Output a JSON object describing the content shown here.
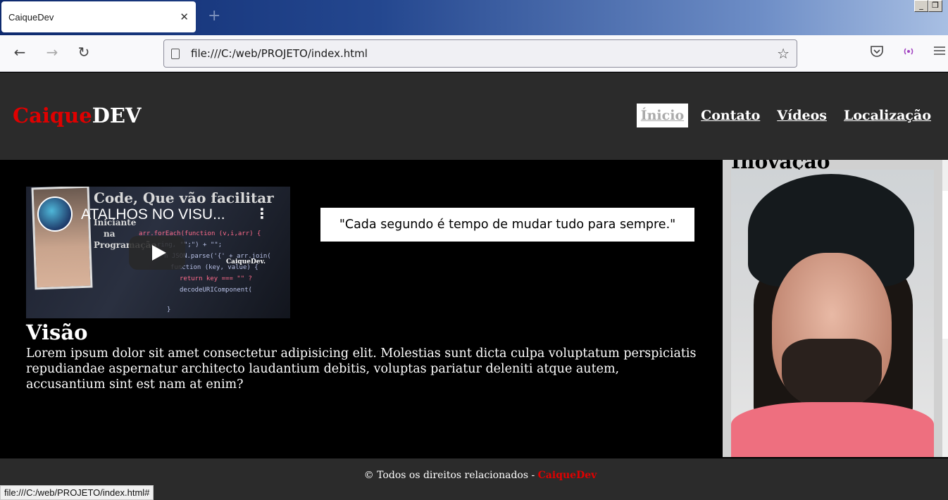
{
  "browser": {
    "tab_title": "CaiqueDev",
    "tab_close": "✕",
    "new_tab": "+",
    "url": "file:///C:/web/PROJETO/index.html",
    "status_url": "file:///C:/web/PROJETO/index.html#",
    "back": "←",
    "forward": "→",
    "reload": "↻",
    "bookmark": "☆",
    "window_minimize": "_",
    "window_restore": "❐"
  },
  "header": {
    "logo_part1": "Caique",
    "logo_part2": "DEV",
    "menu": [
      {
        "label": "Ínicio",
        "active": true
      },
      {
        "label": "Contato"
      },
      {
        "label": "Vídeos"
      },
      {
        "label": "Localização"
      }
    ]
  },
  "video": {
    "title": "ATALHOS NO VISU...",
    "thumb_heading": "Code, Que vão facilitar",
    "thumb_side": [
      "Iniciante",
      "na",
      "Programação"
    ],
    "brand": "CaiqueDev.",
    "code": [
      "arr.forEach(function (v,i,arr) {",
      "ring, \"\";\") + \"\";",
      "n JSON.parse('{' + arr.join(",
      "function (key, value) {",
      "return key === \"\" ?",
      "decodeURIComponent(",
      "}"
    ]
  },
  "quote": "\"Cada segundo é tempo de mudar tudo para sempre.\"",
  "vision": {
    "title": "Visão",
    "text": "Lorem ipsum dolor sit amet consectetur adipisicing elit. Molestias sunt dicta culpa voluptatum perspiciatis repudiandae aspernatur architecto laudantium debitis, voluptas pariatur deleniti atque autem, accusantium sint est nam at enim?"
  },
  "aside": {
    "title": "Inovação"
  },
  "footer": {
    "text": "© Todos os direitos relacionados - ",
    "brand": "CaiqueDev"
  },
  "colors": {
    "accent": "#e00000",
    "header_bg": "#2b2b2b",
    "main_bg": "#000000"
  }
}
